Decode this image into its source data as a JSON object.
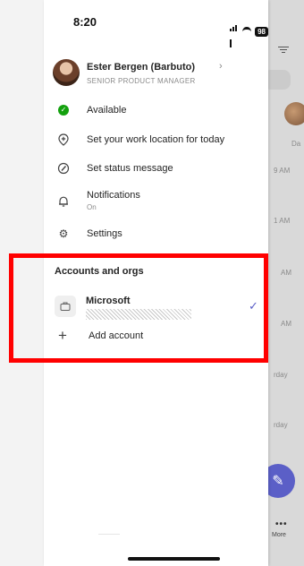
{
  "status_bar": {
    "time": "8:20",
    "battery": "98"
  },
  "profile": {
    "name": "Ester Bergen (Barbuto)",
    "title": "SENIOR PRODUCT MANAGER",
    "chevron": "›"
  },
  "menu": {
    "available": "Available",
    "work_location": "Set your work location for today",
    "status_message": "Set status message",
    "notifications": "Notifications",
    "notifications_state": "On",
    "settings": "Settings"
  },
  "accounts": {
    "heading": "Accounts and orgs",
    "org_name": "Microsoft",
    "add_account": "Add account"
  },
  "background": {
    "avatar_label": "Da",
    "times": [
      "9 AM",
      "1 AM",
      "AM",
      "AM",
      "rday",
      "rday"
    ],
    "more": "More"
  },
  "colors": {
    "accent": "#5b5fc7",
    "available": "#13a10e",
    "highlight": "#ff0000"
  },
  "icons": [
    "check-circle-icon",
    "location-plus-icon",
    "pencil-status-icon",
    "bell-icon",
    "gear-icon",
    "briefcase-icon",
    "checkmark-icon",
    "plus-icon"
  ]
}
